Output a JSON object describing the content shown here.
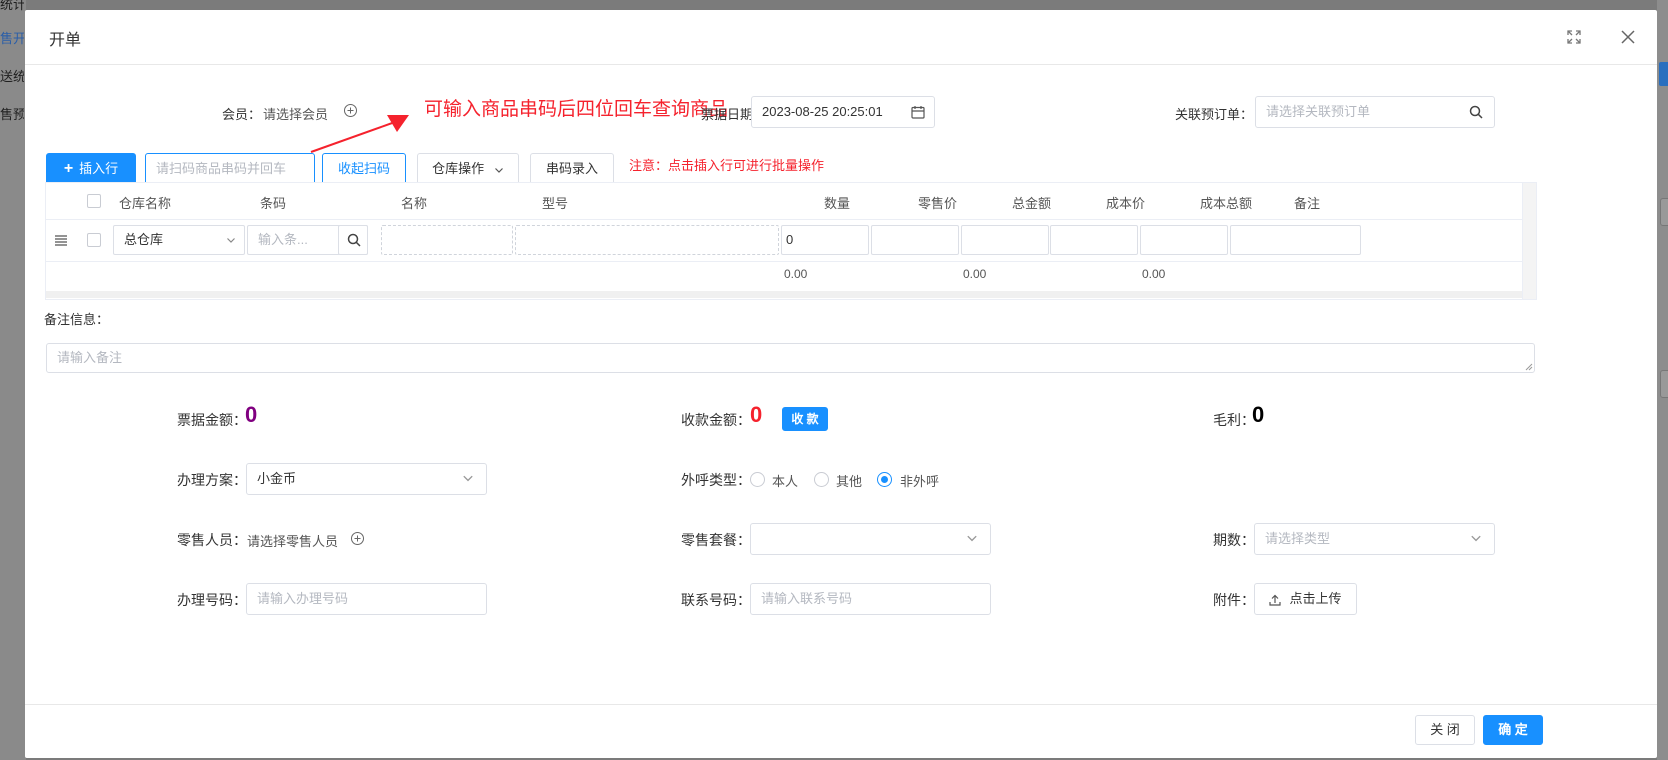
{
  "background": {
    "left_texts": [
      "统计",
      "售开",
      "送统",
      "售预"
    ],
    "accent_color": "#1890ff"
  },
  "modal": {
    "title": "开单",
    "icons": [
      "fullscreen-icon",
      "close-icon"
    ]
  },
  "annotation": {
    "text": "可输入商品串码后四位回车查询商品",
    "color": "#f5222d"
  },
  "top_form": {
    "member_label": "会员：",
    "member_placeholder": "请选择会员",
    "date_label": "票据日期：",
    "date_value": "2023-08-25 20:25:01",
    "preorder_label": "关联预订单：",
    "preorder_placeholder": "请选择关联预订单"
  },
  "toolbar": {
    "insert_row": "插入行",
    "scan_placeholder": "请扫码商品串码并回车",
    "collapse_scan": "收起扫码",
    "warehouse_ops": "仓库操作",
    "serial_entry": "串码录入",
    "note": "注意：点击插入行可进行批量操作"
  },
  "table": {
    "headers": {
      "warehouse": "仓库名称",
      "barcode": "条码",
      "name": "名称",
      "model": "型号",
      "quantity": "数量",
      "retail_price": "零售价",
      "total_amount": "总金额",
      "cost_price": "成本价",
      "cost_total": "成本总额",
      "remark": "备注"
    },
    "row": {
      "warehouse": "总仓库",
      "barcode_placeholder": "输入条...",
      "quantity": "0"
    },
    "sums": {
      "quantity": "0.00",
      "total_amount": "0.00",
      "cost_total": "0.00"
    }
  },
  "remarks": {
    "label": "备注信息：",
    "placeholder": "请输入备注"
  },
  "amounts": {
    "bill_label": "票据金额：",
    "bill_value": "0",
    "bill_color": "#800080",
    "received_label": "收款金额：",
    "received_value": "0",
    "received_color": "#f5222d",
    "collect_button": "收 款",
    "profit_label": "毛利：",
    "profit_value": "0",
    "profit_color": "#000000"
  },
  "form": {
    "plan_label": "办理方案：",
    "plan_value": "小金币",
    "call_type_label": "外呼类型：",
    "call_type_options": [
      "本人",
      "其他",
      "非外呼"
    ],
    "call_type_selected": "非外呼",
    "sales_person_label": "零售人员：",
    "sales_person_placeholder": "请选择零售人员",
    "package_label": "零售套餐：",
    "package_value": "",
    "periods_label": "期数：",
    "periods_placeholder": "请选择类型",
    "handle_no_label": "办理号码：",
    "handle_no_placeholder": "请输入办理号码",
    "contact_label": "联系号码：",
    "contact_placeholder": "请输入联系号码",
    "attachment_label": "附件：",
    "upload_button": "点击上传"
  },
  "footer": {
    "close": "关 闭",
    "confirm": "确 定"
  }
}
